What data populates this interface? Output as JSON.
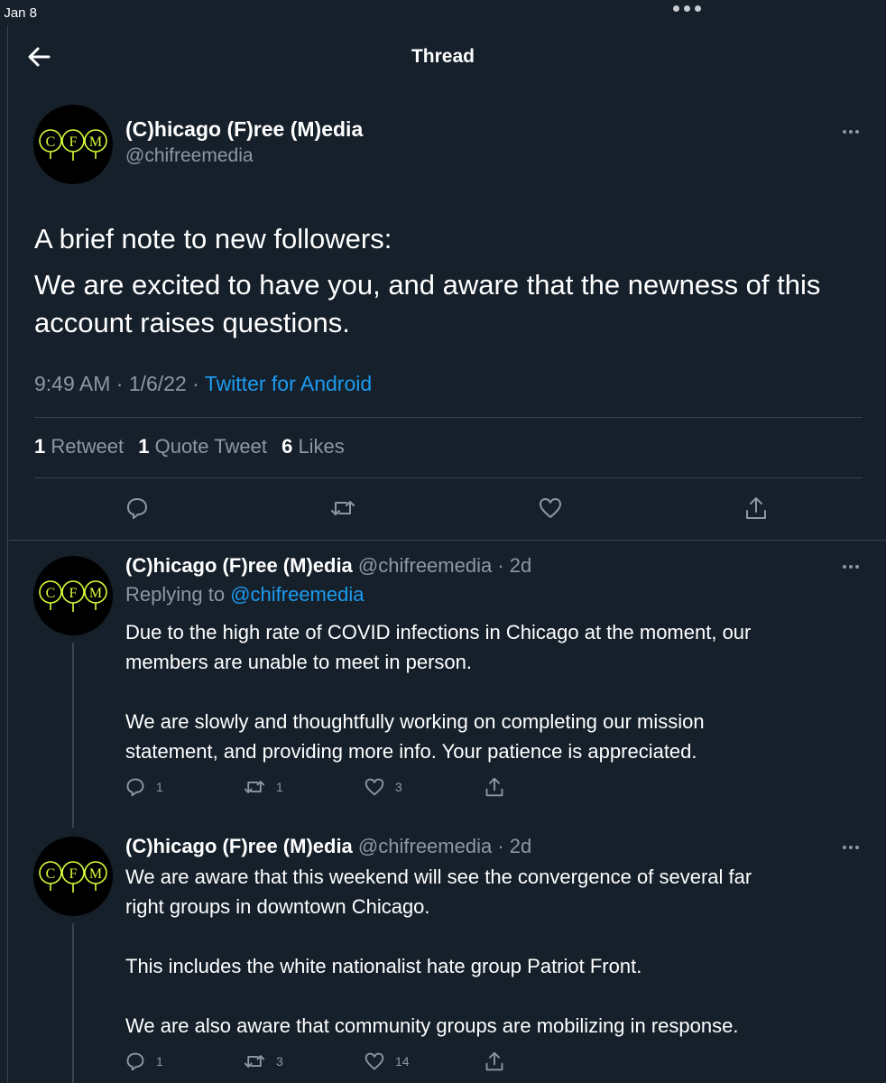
{
  "statusbar": {
    "time": "t Jan 8"
  },
  "header": {
    "title": "Thread"
  },
  "main_tweet": {
    "name": "(C)hicago (F)ree (M)edia",
    "handle": "@chifreemedia",
    "text_lines": [
      "A brief note to new followers:",
      "We are excited to have you, and aware that the newness of this",
      "account raises questions."
    ],
    "time": "9:49 AM · 1/6/22 · ",
    "source": "Twitter for Android",
    "stats": {
      "retweets_count": "1",
      "retweets_label": "Retweet",
      "quotes_count": "1",
      "quotes_label": "Quote Tweet",
      "likes_count": "6",
      "likes_label": "Likes"
    },
    "avatar_text": "CFM"
  },
  "replies": [
    {
      "name": "(C)hicago (F)ree (M)edia",
      "handle_time": "@chifreemedia · 2d",
      "replying_label": "Replying to ",
      "replying_handle": "@chifreemedia",
      "text_lines": [
        "Due to the high rate of COVID infections in Chicago at the moment, our",
        "members are unable to meet in person.",
        "",
        "We are slowly and thoughtfully working on completing our mission",
        "statement, and providing more info. Your patience is appreciated."
      ],
      "reply_count": "1",
      "retweet_count": "1",
      "like_count": "3"
    },
    {
      "name": "(C)hicago (F)ree (M)edia",
      "handle_time": "@chifreemedia · 2d",
      "text_lines": [
        "We are aware that this weekend will see the convergence of several far",
        "right groups in downtown Chicago.",
        "",
        "This includes the white nationalist hate group Patriot Front.",
        "",
        "We are also aware that community groups are mobilizing in response."
      ],
      "reply_count": "1",
      "retweet_count": "3",
      "like_count": "14"
    }
  ],
  "colors": {
    "background": "#15202b",
    "accent": "#1d9bf0",
    "secondary_text": "#8b98a5",
    "divider": "#38444d",
    "avatar_glow": "#d7ff3a"
  },
  "icons": [
    "back-arrow-icon",
    "more-icon",
    "reply-icon",
    "retweet-icon",
    "like-icon",
    "share-icon"
  ]
}
